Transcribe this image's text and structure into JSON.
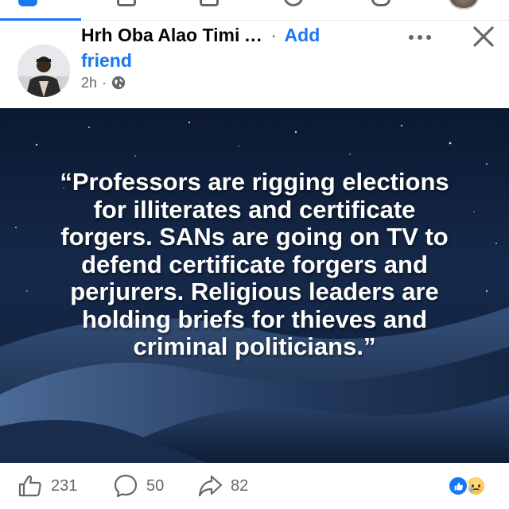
{
  "colors": {
    "accent": "#1877f2",
    "secondary_text": "#65676b",
    "primary_text": "#050505",
    "image_bg": "#0d1c33"
  },
  "header": {
    "name": "Hrh Oba Alao Timi",
    "ellipsis": "...",
    "separator": "·",
    "add_friend_label": "Add friend",
    "timestamp": "2h",
    "meta_separator": "·",
    "audience_icon": "globe-icon",
    "more_icon": "more-dots-icon",
    "close_icon": "close-icon"
  },
  "post": {
    "quote_text": "“Professors are rigging elections\nfor illiterates and certificate\nforgers. SANs are going on TV to\ndefend certificate forgers and\nperjurers. Religious leaders are\nholding briefs for thieves and\ncriminal politicians.”"
  },
  "actions": {
    "likes_count": "231",
    "comments_count": "50",
    "shares_count": "82",
    "like_icon": "thumbs-up-icon",
    "comment_icon": "comment-bubble-icon",
    "share_icon": "share-arrow-icon",
    "reaction_icons": [
      "like-reaction-icon",
      "sad-reaction-icon"
    ]
  }
}
